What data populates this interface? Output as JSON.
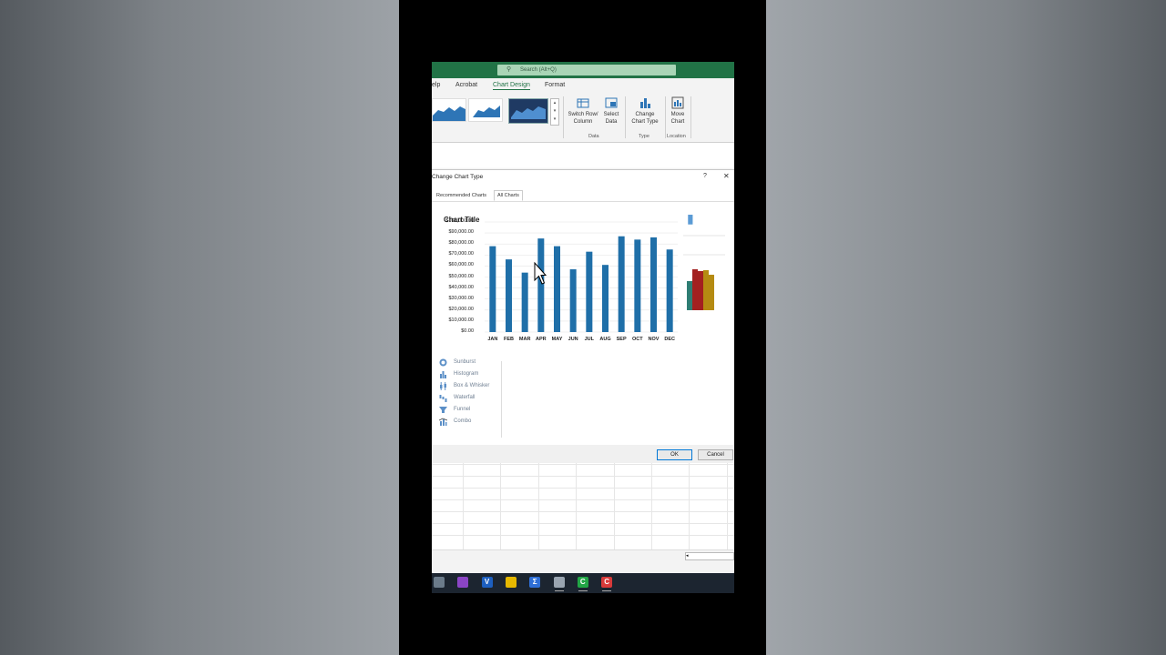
{
  "ribbon": {
    "search_placeholder": "Search (Alt+Q)",
    "tabs": [
      {
        "label": "elp"
      },
      {
        "label": "Acrobat"
      },
      {
        "label": "Chart Design",
        "active": true
      },
      {
        "label": "Format"
      }
    ],
    "buttons": {
      "switch_row_column": "Switch Row/ Column",
      "select_data": "Select Data",
      "change_chart_type": "Change Chart Type",
      "move_chart": "Move Chart"
    },
    "groups": {
      "data": "Data",
      "type": "Type",
      "location": "Location"
    },
    "accent_color": "#217346"
  },
  "dialog": {
    "title": "Change Chart Type",
    "help": "?",
    "close": "✕",
    "tabs": [
      {
        "label": "Recommended Charts"
      },
      {
        "label": "All Charts",
        "active": true
      }
    ],
    "chart_types": [
      {
        "label": "Sunburst",
        "icon": "sunburst-icon"
      },
      {
        "label": "Histogram",
        "icon": "histogram-icon"
      },
      {
        "label": "Box & Whisker",
        "icon": "box-whisker-icon"
      },
      {
        "label": "Waterfall",
        "icon": "waterfall-icon"
      },
      {
        "label": "Funnel",
        "icon": "funnel-icon"
      },
      {
        "label": "Combo",
        "icon": "combo-icon"
      }
    ],
    "ok": "OK",
    "cancel": "Cancel"
  },
  "chart_data": {
    "type": "bar",
    "title": "Chart Title",
    "categories": [
      "JAN",
      "FEB",
      "MAR",
      "APR",
      "MAY",
      "JUN",
      "JUL",
      "AUG",
      "SEP",
      "OCT",
      "NOV",
      "DEC"
    ],
    "values": [
      78000,
      66000,
      54000,
      85000,
      78000,
      57000,
      73000,
      61000,
      87000,
      84000,
      86000,
      75000
    ],
    "ylim": [
      0,
      100000
    ],
    "yticks": [
      "$100,000.00",
      "$90,000.00",
      "$80,000.00",
      "$70,000.00",
      "$60,000.00",
      "$50,000.00",
      "$40,000.00",
      "$30,000.00",
      "$20,000.00",
      "$10,000.00",
      "$0.00"
    ],
    "xlabel": "",
    "ylabel": "",
    "grid": true,
    "bar_color": "#1f6fa8"
  },
  "taskbar": {
    "apps": [
      {
        "icon": "cloud-app-icon",
        "color": "#6b7b8a"
      },
      {
        "icon": "drop-app-icon",
        "color": "#8b45c5"
      },
      {
        "icon": "v-app-icon",
        "color": "#1d5fbf",
        "glyph": "V"
      },
      {
        "icon": "powerbi-icon",
        "color": "#e6b800"
      },
      {
        "icon": "sigma-app-icon",
        "color": "#2f6fd6",
        "glyph": "Σ"
      },
      {
        "icon": "chrome-app-icon",
        "color": "#9aa5b1"
      },
      {
        "icon": "camtasia-green-icon",
        "color": "#22a646",
        "glyph": "C"
      },
      {
        "icon": "camtasia-red-icon",
        "color": "#d83a3a",
        "glyph": "C"
      }
    ]
  }
}
